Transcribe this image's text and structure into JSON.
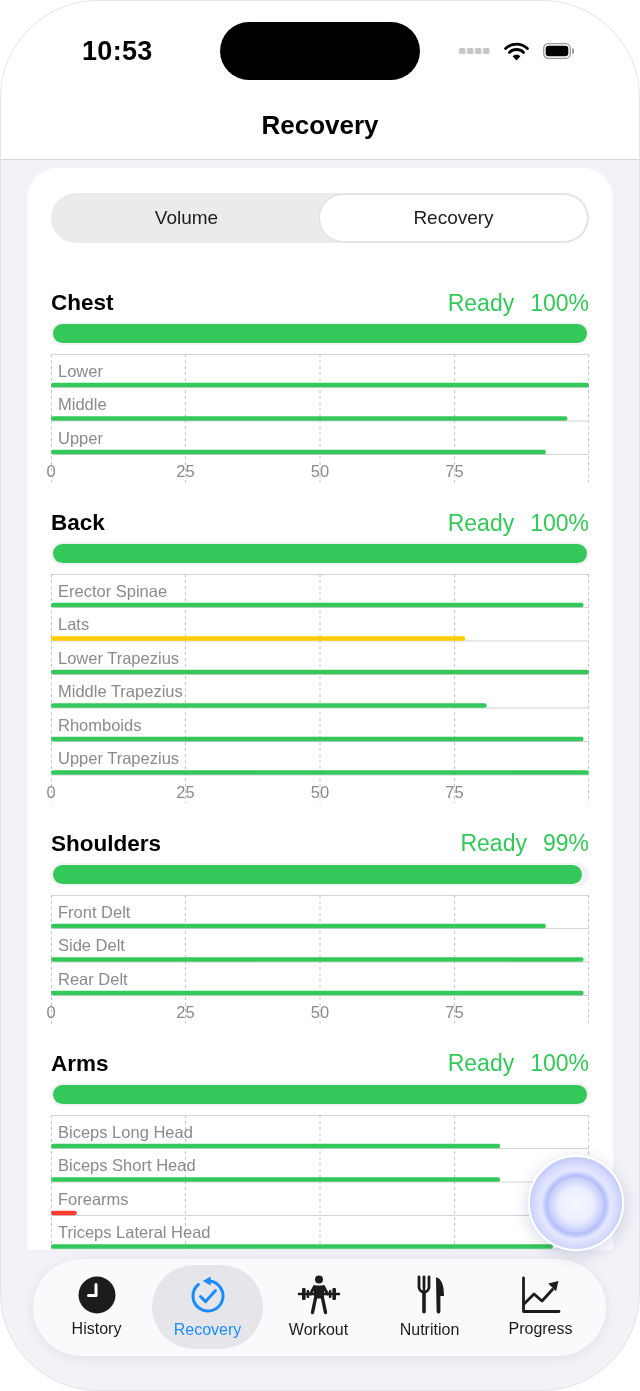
{
  "status_bar": {
    "time": "10:53"
  },
  "nav_bar": {
    "title": "Recovery"
  },
  "segments": [
    {
      "label": "Volume",
      "selected": false
    },
    {
      "label": "Recovery",
      "selected": true
    }
  ],
  "sections": [
    {
      "title": "Chest",
      "status": "Ready",
      "percent": "100%",
      "level": 1,
      "chart_data": {
        "type": "bar",
        "orientation": "horizontal",
        "categories": [
          "Lower",
          "Middle",
          "Upper"
        ],
        "values": [
          100,
          96,
          92
        ],
        "colors": [
          "#34c759",
          "#34c759",
          "#34c759"
        ],
        "xlim": [
          0,
          100
        ],
        "xticks": [
          0,
          25,
          50,
          75
        ],
        "grid": true
      }
    },
    {
      "title": "Back",
      "status": "Ready",
      "percent": "100%",
      "level": 1,
      "chart_data": {
        "type": "bar",
        "orientation": "horizontal",
        "categories": [
          "Erector Spinae",
          "Lats",
          "Lower Trapezius",
          "Middle Trapezius",
          "Rhomboids",
          "Upper Trapezius"
        ],
        "values": [
          99,
          77,
          100,
          81,
          99,
          100
        ],
        "colors": [
          "#34c759",
          "#ffcc00",
          "#34c759",
          "#34c759",
          "#34c759",
          "#34c759"
        ],
        "xlim": [
          0,
          100
        ],
        "xticks": [
          0,
          25,
          50,
          75
        ],
        "grid": true
      }
    },
    {
      "title": "Shoulders",
      "status": "Ready",
      "percent": "99%",
      "level": 0.99,
      "chart_data": {
        "type": "bar",
        "orientation": "horizontal",
        "categories": [
          "Front Delt",
          "Side Delt",
          "Rear Delt"
        ],
        "values": [
          92,
          99,
          99
        ],
        "colors": [
          "#34c759",
          "#34c759",
          "#34c759"
        ],
        "xlim": [
          0,
          100
        ],
        "xticks": [
          0,
          25,
          50,
          75
        ],
        "grid": true
      }
    },
    {
      "title": "Arms",
      "status": "Ready",
      "percent": "100%",
      "level": 1,
      "rows": [
        {
          "label": "Biceps Long Head",
          "color": "#34c759"
        },
        {
          "label": "Biceps Short Head",
          "color": "#34c759"
        },
        {
          "label": "Forearms",
          "color": "#ff3b30"
        },
        {
          "label": "Triceps Lateral Head",
          "color": "#34c759"
        }
      ]
    }
  ],
  "tab_bar": [
    {
      "label": "History",
      "selected": false
    },
    {
      "label": "Recovery",
      "selected": true
    },
    {
      "label": "Workout",
      "selected": false
    },
    {
      "label": "Nutrition",
      "selected": false
    },
    {
      "label": "Progress",
      "selected": false
    }
  ]
}
